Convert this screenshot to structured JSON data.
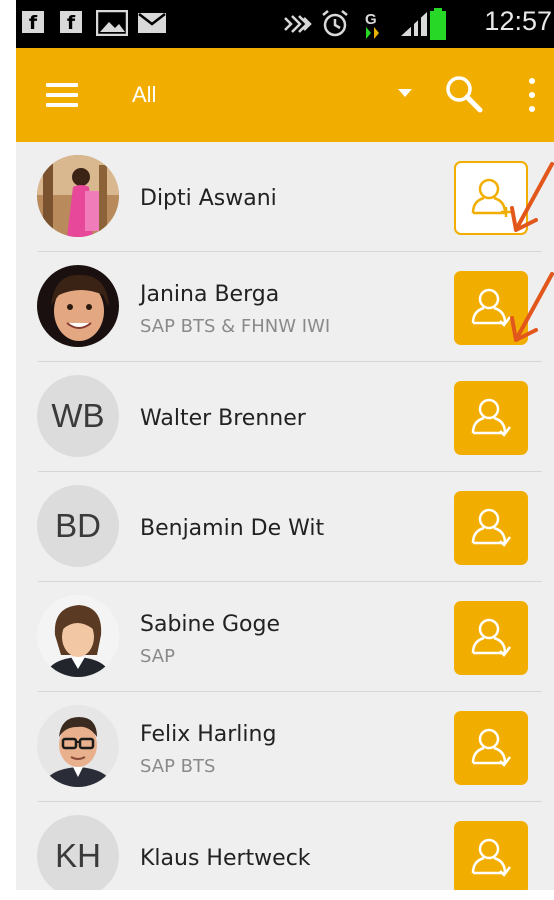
{
  "statusbar": {
    "time": "12:57",
    "left_icons": [
      "facebook-icon",
      "facebook-icon",
      "image-icon",
      "mail-icon"
    ],
    "right_icons": [
      "nfc-icon",
      "alarm-icon",
      "sync-icon",
      "signal-icon",
      "battery-icon"
    ],
    "battery_color": "#27d827"
  },
  "appbar": {
    "filter_label": "All",
    "color": "#f2ae00"
  },
  "contacts": [
    {
      "name": "Dipti Aswani",
      "subtitle": "",
      "initials": "",
      "action": "add-contact"
    },
    {
      "name": "Janina Berga",
      "subtitle": "SAP BTS & FHNW IWI",
      "initials": "",
      "action": "contact-added"
    },
    {
      "name": "Walter Brenner",
      "subtitle": "",
      "initials": "WB",
      "action": "contact-added"
    },
    {
      "name": "Benjamin De Wit",
      "subtitle": "",
      "initials": "BD",
      "action": "contact-added"
    },
    {
      "name": "Sabine Goge",
      "subtitle": "SAP",
      "initials": "",
      "action": "contact-added"
    },
    {
      "name": "Felix Harling",
      "subtitle": "SAP BTS",
      "initials": "",
      "action": "contact-added"
    },
    {
      "name": "Klaus Hertweck",
      "subtitle": "",
      "initials": "KH",
      "action": "contact-added"
    }
  ],
  "annotation_color": "#e2571c"
}
